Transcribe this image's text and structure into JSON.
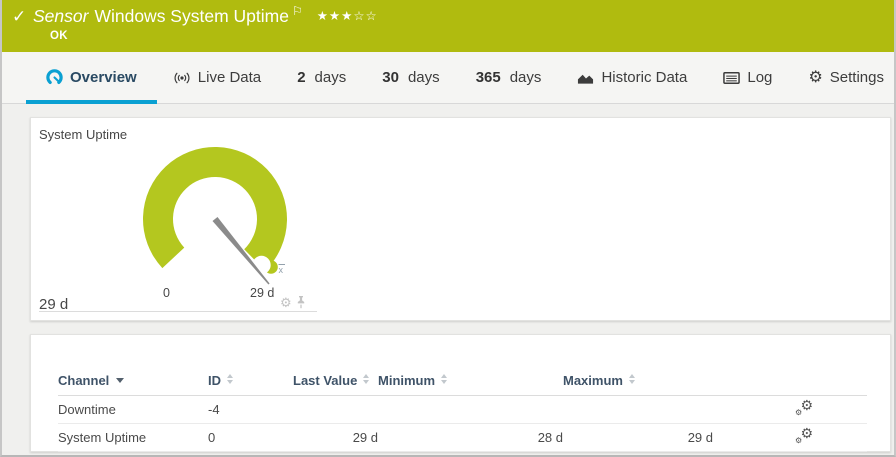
{
  "header": {
    "kind_label": "Sensor",
    "title": "Windows System Uptime",
    "status": "OK",
    "rating": {
      "filled": 3,
      "total": 5,
      "stars_filled": "★★★",
      "stars_empty": "☆☆"
    },
    "color": "#b0bb0f"
  },
  "icons": {
    "check": "✓",
    "flag": "⚐",
    "gear": "⚙",
    "mean_marker": "x"
  },
  "tabs": [
    {
      "label": "Overview",
      "active": true
    },
    {
      "label": "Live Data"
    },
    {
      "value": "2",
      "label": "days"
    },
    {
      "value": "30",
      "label": "days"
    },
    {
      "value": "365",
      "label": "days"
    },
    {
      "label": "Historic Data"
    },
    {
      "label": "Log"
    },
    {
      "label": "Settings"
    }
  ],
  "accent": {
    "active_tab": "#0aa0d2"
  },
  "gauge_panel": {
    "title": "System Uptime",
    "scale_min": "0",
    "scale_max": "29 d",
    "current_value": "29 d",
    "ring_color": "#b4c71f"
  },
  "table": {
    "columns": {
      "channel": "Channel",
      "id": "ID",
      "last_value": "Last Value",
      "minimum": "Minimum",
      "maximum": "Maximum"
    },
    "rows": [
      {
        "channel": "Downtime",
        "id": "-4",
        "last_value": "",
        "minimum": "",
        "maximum": ""
      },
      {
        "channel": "System Uptime",
        "id": "0",
        "last_value": "29 d",
        "minimum": "28 d",
        "maximum": "29 d"
      }
    ]
  }
}
